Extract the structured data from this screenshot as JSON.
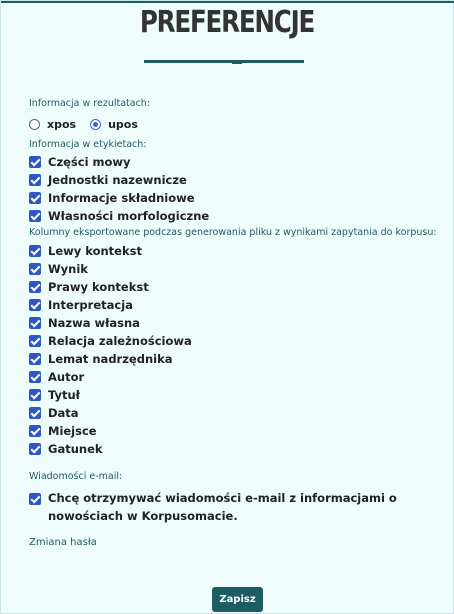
{
  "page": {
    "title": "PREFERENCJE"
  },
  "results": {
    "label": "Informacja w rezultatach:",
    "options": [
      {
        "label": "xpos",
        "selected": false
      },
      {
        "label": "upos",
        "selected": true
      }
    ]
  },
  "tags": {
    "label": "Informacja w etykietach:",
    "items": [
      "Części mowy",
      "Jednostki nazewnicze",
      "Informacje składniowe",
      "Własności morfologiczne"
    ]
  },
  "export": {
    "label": "Kolumny eksportowane podczas generowania pliku z wynikami zapytania do korpusu:",
    "items": [
      "Lewy kontekst",
      "Wynik",
      "Prawy kontekst",
      "Interpretacja",
      "Nazwa własna",
      "Relacja zależnościowa",
      "Lemat nadrzędnika",
      "Autor",
      "Tytuł",
      "Data",
      "Miejsce",
      "Gatunek"
    ]
  },
  "email": {
    "label": "Wiadomości e-mail:",
    "text": "Chcę otrzymywać wiadomości e-mail z informacjami o nowościach w Korpusomacie."
  },
  "password_link": "Zmiana hasła",
  "save_label": "Zapisz",
  "colors": {
    "accent": "#1d5d62",
    "checkbox": "#2e57c5",
    "background": "#effcfc"
  }
}
